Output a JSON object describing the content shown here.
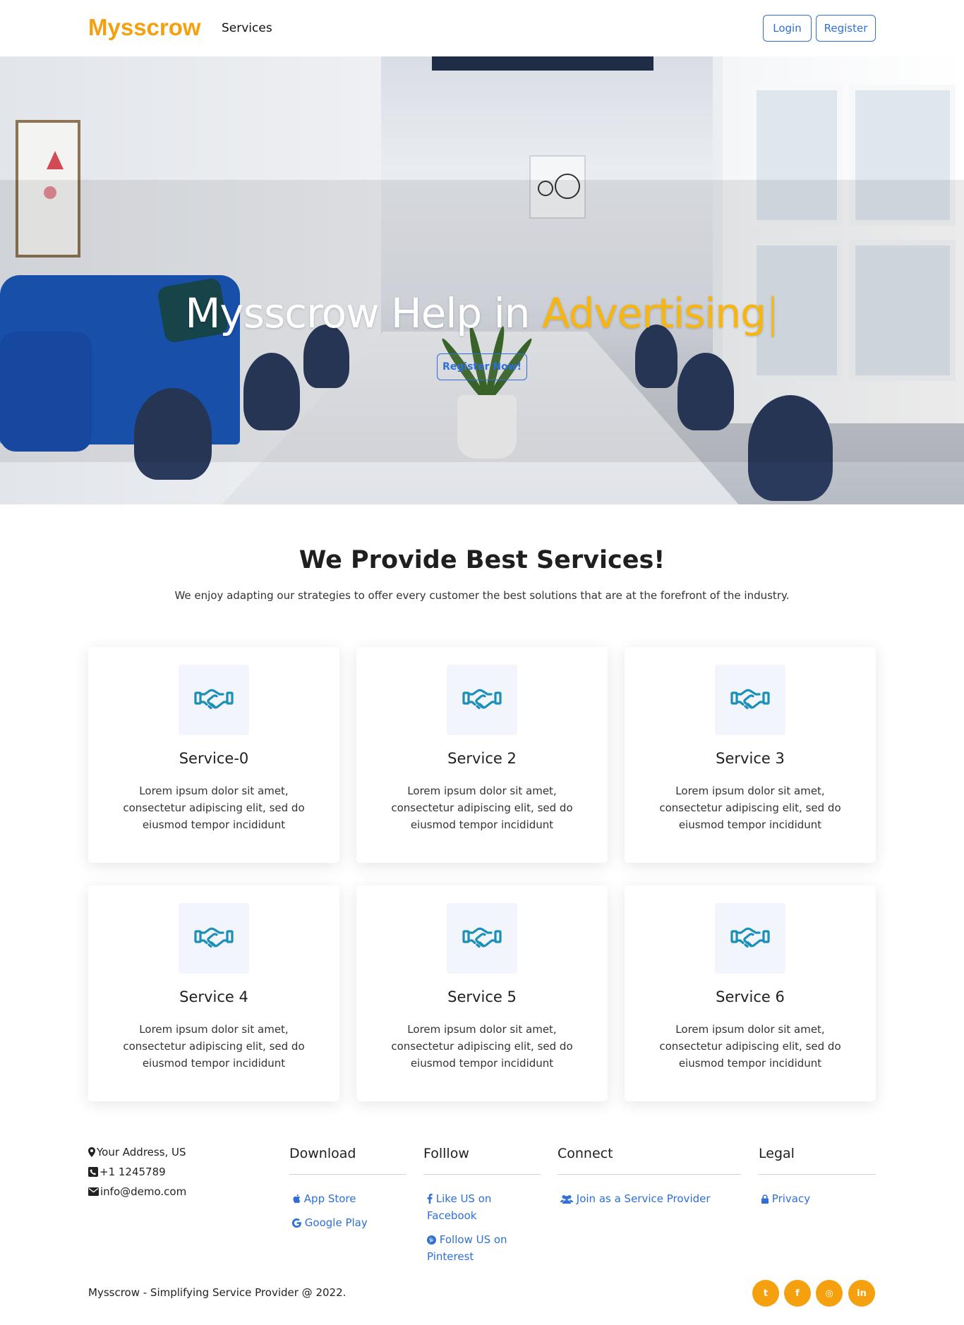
{
  "nav": {
    "brand": "Mysscrow",
    "services_link": "Services",
    "login": "Login",
    "register": "Register"
  },
  "hero": {
    "title_prefix": "Mysscrow Help in ",
    "title_accent": "Advertising",
    "caret": "|",
    "cta": "Register Now!"
  },
  "services": {
    "title": "We Provide Best Services!",
    "subtitle": "We enjoy adapting our strategies to offer every customer the best solutions that are at the forefront of the industry.",
    "cards": [
      {
        "title": "Service-0",
        "desc": "Lorem ipsum dolor sit amet, consectetur adipiscing elit, sed do eiusmod tempor incididunt",
        "icon": "handshake-icon"
      },
      {
        "title": "Service 2",
        "desc": "Lorem ipsum dolor sit amet, consectetur adipiscing elit, sed do eiusmod tempor incididunt",
        "icon": "handshake-icon"
      },
      {
        "title": "Service 3",
        "desc": "Lorem ipsum dolor sit amet, consectetur adipiscing elit, sed do eiusmod tempor incididunt",
        "icon": "handshake-icon"
      },
      {
        "title": "Service 4",
        "desc": "Lorem ipsum dolor sit amet, consectetur adipiscing elit, sed do eiusmod tempor incididunt",
        "icon": "handshake-icon"
      },
      {
        "title": "Service 5",
        "desc": "Lorem ipsum dolor sit amet, consectetur adipiscing elit, sed do eiusmod tempor incididunt",
        "icon": "handshake-icon"
      },
      {
        "title": "Service 6",
        "desc": "Lorem ipsum dolor sit amet, consectetur adipiscing elit, sed do eiusmod tempor incididunt",
        "icon": "handshake-icon"
      }
    ]
  },
  "footer": {
    "address": "Your Address, US",
    "phone": "+1 1245789",
    "email": "info@demo.com",
    "download": {
      "heading": "Download",
      "app_store": "App Store",
      "google_play": "Google Play"
    },
    "follow": {
      "heading": "Folllow",
      "facebook": "Like US on Facebook",
      "pinterest": "Follow US on Pinterest"
    },
    "connect": {
      "heading": "Connect",
      "provider": "Join as a Service Provider"
    },
    "legal": {
      "heading": "Legal",
      "privacy": "Privacy"
    },
    "copyright": "Mysscrow - Simplifying Service Provider @ 2022.",
    "social": [
      {
        "name": "twitter-icon",
        "glyph": "t"
      },
      {
        "name": "facebook-icon",
        "glyph": "f"
      },
      {
        "name": "instagram-icon",
        "glyph": "◎"
      },
      {
        "name": "linkedin-icon",
        "glyph": "in"
      }
    ]
  },
  "colors": {
    "brand": "#f5a00f",
    "accent_yellow": "#f7b50f",
    "link_blue": "#2f6fd6",
    "icon_teal": "#1c8fb8"
  }
}
